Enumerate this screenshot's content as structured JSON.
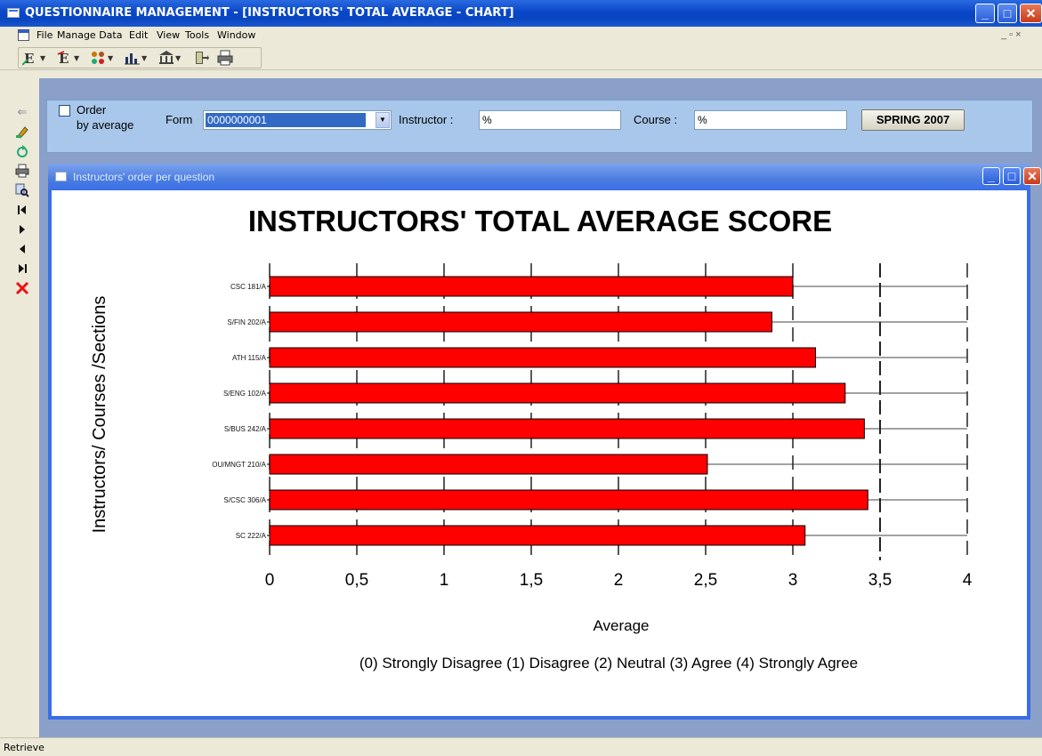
{
  "window": {
    "title": "QUESTIONNAIRE MANAGEMENT - [INSTRUCTORS' TOTAL AVERAGE - CHART]",
    "min_glyph": "_",
    "max_glyph": "□",
    "close_glyph": "✕"
  },
  "menu": {
    "items": [
      "File",
      "Manage Data",
      "Edit",
      "View",
      "Tools",
      "Window"
    ],
    "mdi_controls": "_ ▫ ×"
  },
  "toolbar": {
    "icons": [
      "export-e-icon",
      "export-e2-icon",
      "group-icon",
      "chart-icon",
      "bank-icon",
      "exit-icon",
      "print-icon"
    ]
  },
  "left_toolbar": {
    "icons": [
      "back-icon",
      "edit-icon",
      "refresh-icon",
      "print-icon",
      "search-icon",
      "first-record-icon",
      "next-record-icon",
      "prev-record-icon",
      "last-record-icon",
      "delete-icon"
    ]
  },
  "filter": {
    "order_label_line1": "Order",
    "order_label_line2": "by average",
    "form_label": "Form",
    "form_value": "0000000001",
    "instructor_label": "Instructor :",
    "instructor_value": "%",
    "course_label": "Course :",
    "course_value": "%",
    "season_button": "SPRING 2007"
  },
  "inner_window": {
    "title": "Instructors' order per question"
  },
  "chart_data": {
    "type": "bar",
    "orientation": "horizontal",
    "title": "INSTRUCTORS' TOTAL AVERAGE SCORE",
    "xlabel": "Average",
    "ylabel": "Instructors/ Courses /Sections",
    "categories": [
      "",
      "",
      "",
      "",
      "",
      "",
      "",
      ""
    ],
    "category_suffixes": [
      "CSC 181/A",
      "S/FIN 202/A",
      "ATH 115/A",
      "S/ENG 102/A",
      "S/BUS 242/A",
      "OU/MNGT 210/A",
      "S/CSC 306/A",
      "SC 222/A"
    ],
    "values": [
      3.0,
      2.88,
      3.13,
      3.3,
      3.41,
      2.51,
      3.43,
      3.07
    ],
    "xlim": [
      0,
      4
    ],
    "xticks": [
      "0",
      "0,5",
      "1",
      "1,5",
      "2",
      "2,5",
      "3",
      "3,5",
      "4"
    ],
    "bar_color": "#ff0000",
    "grid": true,
    "scale_note": "(0) Strongly Disagree  (1) Disagree  (2) Neutral  (3) Agree  (4) Strongly Agree"
  },
  "status": {
    "text": "Retrieve"
  }
}
